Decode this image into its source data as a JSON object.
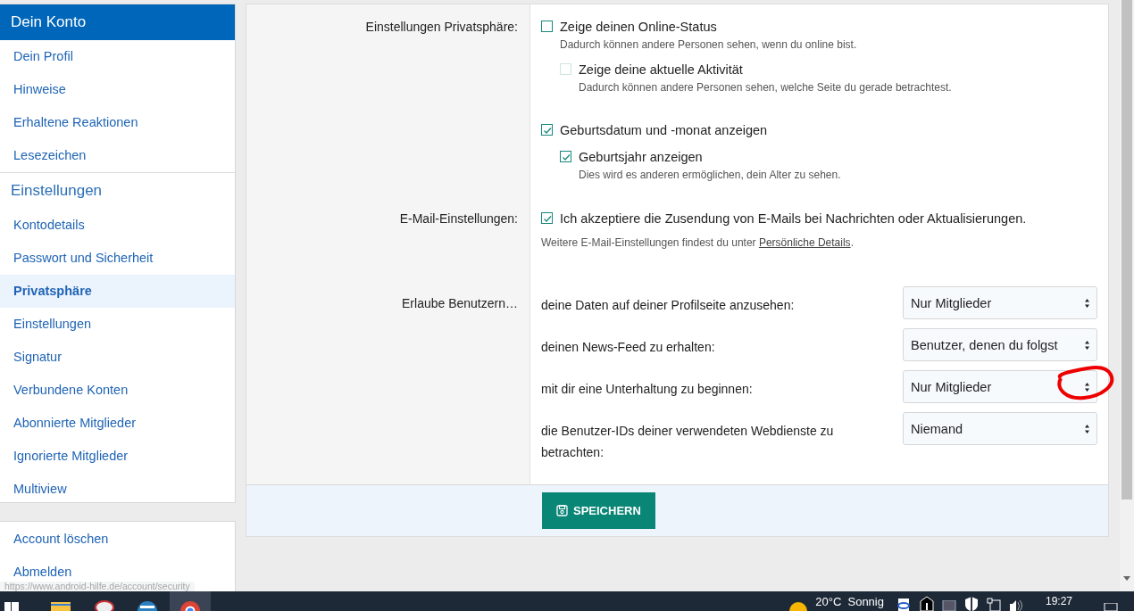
{
  "sidebar": {
    "cards": [
      {
        "sections": [
          {
            "heading": {
              "text": "Dein Konto",
              "highlighted": true
            },
            "items": [
              {
                "label": "Dein Profil",
                "selected": false
              },
              {
                "label": "Hinweise",
                "selected": false
              },
              {
                "label": "Erhaltene Reaktionen",
                "selected": false
              },
              {
                "label": "Lesezeichen",
                "selected": false
              }
            ]
          },
          {
            "heading": {
              "text": "Einstellungen",
              "highlighted": false
            },
            "items": [
              {
                "label": "Kontodetails",
                "selected": false
              },
              {
                "label": "Passwort und Sicherheit",
                "selected": false
              },
              {
                "label": "Privatsphäre",
                "selected": true
              },
              {
                "label": "Einstellungen",
                "selected": false
              },
              {
                "label": "Signatur",
                "selected": false
              },
              {
                "label": "Verbundene Konten",
                "selected": false
              },
              {
                "label": "Abonnierte Mitglieder",
                "selected": false
              },
              {
                "label": "Ignorierte Mitglieder",
                "selected": false
              },
              {
                "label": "Multiview",
                "selected": false
              }
            ]
          }
        ]
      },
      {
        "sections": [
          {
            "items": [
              {
                "label": "Account löschen",
                "selected": false
              },
              {
                "label": "Abmelden",
                "selected": false
              }
            ]
          }
        ]
      }
    ]
  },
  "form": {
    "rows": [
      {
        "kind": "checkboxes",
        "label": "Einstellungen Privatsphäre:",
        "options": [
          {
            "label": "Zeige deinen Online-Status",
            "hint": "Dadurch können andere Personen sehen, wenn du online bist.",
            "checked": false,
            "disabled": false,
            "children": [
              {
                "label": "Zeige deine aktuelle Aktivität",
                "hint": "Dadurch können andere Personen sehen, welche Seite du gerade betrachtest.",
                "checked": false,
                "disabled": true
              }
            ]
          },
          {
            "label": "Geburtsdatum und -monat anzeigen",
            "checked": true,
            "disabled": false,
            "children": [
              {
                "label": "Geburtsjahr anzeigen",
                "hint": "Dies wird es anderen ermöglichen, dein Alter zu sehen.",
                "checked": true,
                "disabled": false
              }
            ]
          }
        ]
      },
      {
        "kind": "checkboxes",
        "label": "E-Mail-Einstellungen:",
        "options": [
          {
            "label": "Ich akzeptiere die Zusendung von E-Mails bei Nachrichten oder Aktualisierungen.",
            "checked": true,
            "disabled": false
          }
        ],
        "note": "Weitere E-Mail-Einstellungen findest du unter ",
        "note_link": "Persönliche Details",
        "note_end": "."
      },
      {
        "kind": "selects",
        "label": "Erlaube Benutzern…",
        "selects": [
          {
            "label": "deine Daten auf deiner Profilseite anzusehen:",
            "value": "Nur Mitglieder"
          },
          {
            "label": "deinen News-Feed zu erhalten:",
            "value": "Benutzer, denen du folgst"
          },
          {
            "label": "mit dir eine Unterhaltung zu beginnen:",
            "value": "Nur Mitglieder"
          },
          {
            "label": "die Benutzer-IDs deiner verwendeten Webdienste zu betrachten:",
            "value": "Niemand"
          }
        ]
      }
    ],
    "submit": "SPEICHERN"
  },
  "status_url": "https://www.android-hilfe.de/account/security",
  "taskbar": {
    "weather": "20°C  Sonnig",
    "clock": "19:27"
  }
}
